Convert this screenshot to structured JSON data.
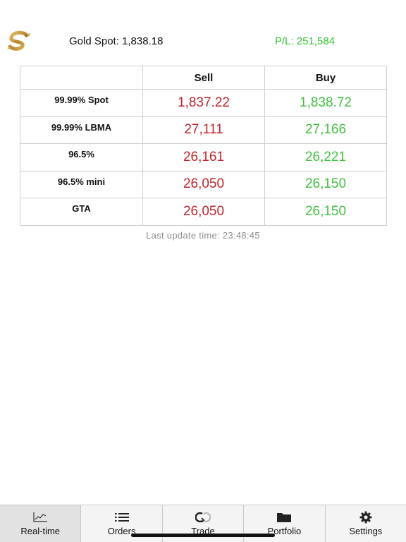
{
  "header": {
    "gold_spot": "Gold Spot: 1,838.18",
    "pl": "P/L: 251,584",
    "colors": {
      "pl": "#34c534",
      "logo": "#c9a24a"
    }
  },
  "table": {
    "columns": [
      "",
      "Sell",
      "Buy"
    ],
    "rows": [
      {
        "label": "99.99% Spot",
        "sell": "1,837.22",
        "buy": "1,838.72"
      },
      {
        "label": "99.99% LBMA",
        "sell": "27,111",
        "buy": "27,166"
      },
      {
        "label": "96.5%",
        "sell": "26,161",
        "buy": "26,221"
      },
      {
        "label": "96.5% mini",
        "sell": "26,050",
        "buy": "26,150"
      },
      {
        "label": "GTA",
        "sell": "26,050",
        "buy": "26,150"
      }
    ],
    "colors": {
      "sell": "#c0262d",
      "buy": "#40c240"
    }
  },
  "last_update": "Last update time: 23:48:45",
  "tabbar": {
    "tabs": [
      {
        "label": "Real-time",
        "icon": "chart-line-icon",
        "active": true
      },
      {
        "label": "Orders",
        "icon": "list-icon",
        "active": false
      },
      {
        "label": "Trade",
        "icon": "exchange-icon",
        "active": false
      },
      {
        "label": "Portfolio",
        "icon": "folder-icon",
        "active": false
      },
      {
        "label": "Settings",
        "icon": "gear-icon",
        "active": false
      }
    ]
  }
}
